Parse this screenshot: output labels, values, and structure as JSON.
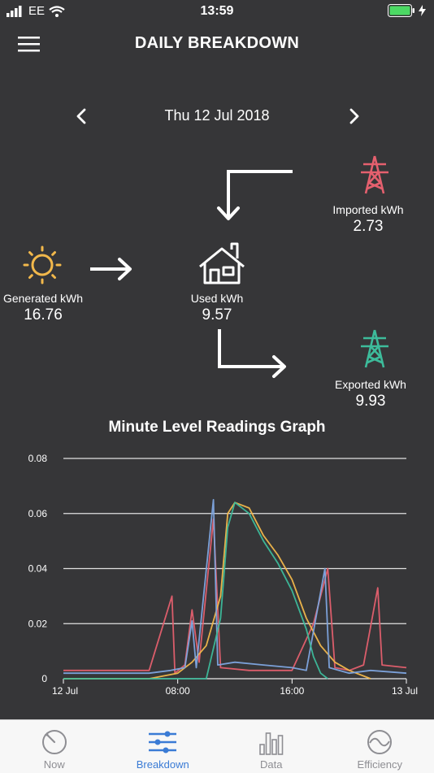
{
  "status_bar": {
    "carrier": "EE",
    "time": "13:59"
  },
  "header": {
    "title": "DAILY BREAKDOWN"
  },
  "date_nav": {
    "date": "Thu 12 Jul 2018"
  },
  "flow": {
    "generated": {
      "label": "Generated kWh",
      "value": "16.76",
      "color": "#f2b84b"
    },
    "used": {
      "label": "Used kWh",
      "value": "9.57"
    },
    "imported": {
      "label": "Imported kWh",
      "value": "2.73",
      "color": "#e5606e"
    },
    "exported": {
      "label": "Exported kWh",
      "value": "9.93",
      "color": "#3dbc9b"
    }
  },
  "chart_title": "Minute Level Readings Graph",
  "chart_data": {
    "type": "line",
    "title": "Minute Level Readings Graph",
    "x_ticks": [
      "12 Jul",
      "08:00",
      "16:00",
      "13 Jul"
    ],
    "y_ticks": [
      "0",
      "0.02",
      "0.04",
      "0.06",
      "0.08"
    ],
    "ylim": [
      0,
      0.08
    ],
    "xlim_hours": [
      0,
      24
    ],
    "grid": true,
    "series": [
      {
        "color": "#e5606e",
        "points": [
          [
            0,
            0.003
          ],
          [
            2,
            0.003
          ],
          [
            4,
            0.003
          ],
          [
            6,
            0.003
          ],
          [
            7.6,
            0.03
          ],
          [
            7.8,
            0.002
          ],
          [
            8.5,
            0.005
          ],
          [
            9,
            0.025
          ],
          [
            9.5,
            0.006
          ],
          [
            10.5,
            0.058
          ],
          [
            11,
            0.004
          ],
          [
            13,
            0.003
          ],
          [
            16,
            0.003
          ],
          [
            17.5,
            0.02
          ],
          [
            18.5,
            0.04
          ],
          [
            19,
            0.004
          ],
          [
            20,
            0.003
          ],
          [
            21,
            0.005
          ],
          [
            22,
            0.033
          ],
          [
            22.3,
            0.005
          ],
          [
            24,
            0.004
          ]
        ]
      },
      {
        "color": "#f2b84b",
        "points": [
          [
            0,
            0
          ],
          [
            6,
            0
          ],
          [
            7,
            0.001
          ],
          [
            8,
            0.002
          ],
          [
            9,
            0.006
          ],
          [
            10,
            0.012
          ],
          [
            11,
            0.03
          ],
          [
            11.5,
            0.06
          ],
          [
            12,
            0.064
          ],
          [
            13,
            0.062
          ],
          [
            14,
            0.052
          ],
          [
            15,
            0.045
          ],
          [
            16,
            0.036
          ],
          [
            17,
            0.022
          ],
          [
            18,
            0.012
          ],
          [
            19,
            0.006
          ],
          [
            20,
            0.003
          ],
          [
            21,
            0.001
          ],
          [
            21.5,
            0
          ]
        ]
      },
      {
        "color": "#7fa7e0",
        "points": [
          [
            0,
            0.002
          ],
          [
            6,
            0.002
          ],
          [
            7.5,
            0.003
          ],
          [
            8.5,
            0.004
          ],
          [
            9,
            0.021
          ],
          [
            9.3,
            0.004
          ],
          [
            10.5,
            0.065
          ],
          [
            10.8,
            0.005
          ],
          [
            12,
            0.006
          ],
          [
            14,
            0.005
          ],
          [
            16,
            0.004
          ],
          [
            17,
            0.003
          ],
          [
            18.3,
            0.04
          ],
          [
            18.6,
            0.004
          ],
          [
            20,
            0.002
          ],
          [
            21.5,
            0.003
          ],
          [
            24,
            0.002
          ]
        ]
      },
      {
        "color": "#3dbc9b",
        "points": [
          [
            0,
            0
          ],
          [
            10,
            0
          ],
          [
            11,
            0.022
          ],
          [
            11.5,
            0.055
          ],
          [
            12,
            0.064
          ],
          [
            13,
            0.06
          ],
          [
            14,
            0.05
          ],
          [
            15,
            0.042
          ],
          [
            16,
            0.032
          ],
          [
            17,
            0.018
          ],
          [
            17.5,
            0.008
          ],
          [
            18,
            0.002
          ],
          [
            18.5,
            0
          ]
        ]
      }
    ]
  },
  "tabs": [
    {
      "label": "Now"
    },
    {
      "label": "Breakdown"
    },
    {
      "label": "Data"
    },
    {
      "label": "Efficiency"
    }
  ]
}
